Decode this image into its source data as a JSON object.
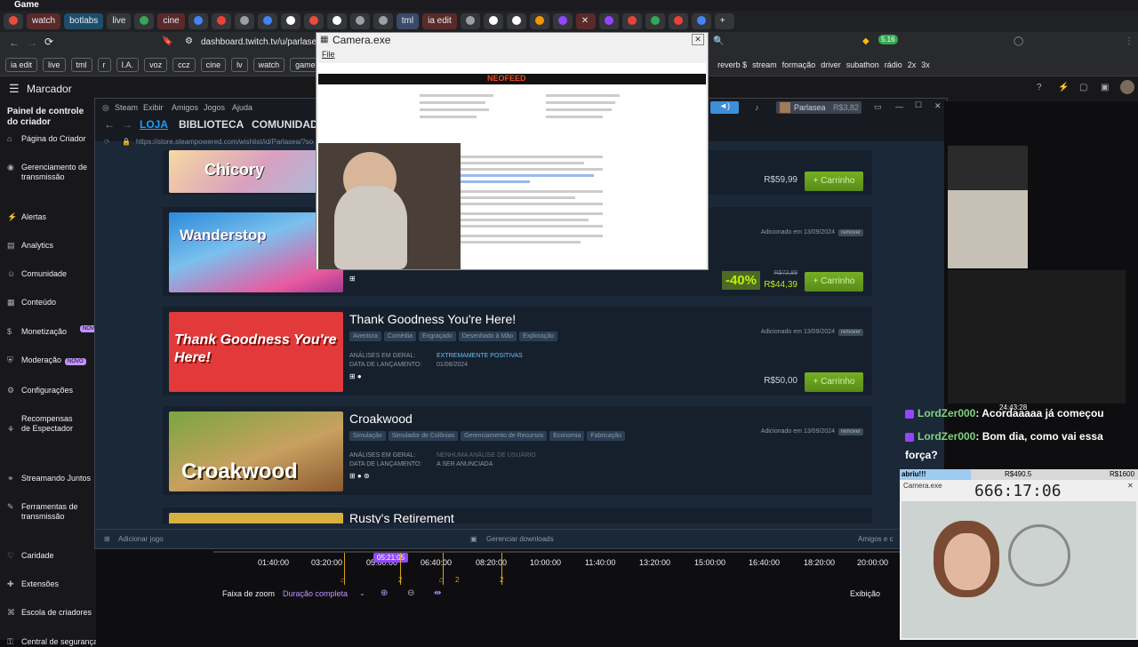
{
  "window_title": "Game",
  "tabs": [
    "watch",
    "botlabs",
    "live",
    "cine",
    "tml",
    "ia edit"
  ],
  "address_bar": {
    "url": "dashboard.twitch.tv/u/parlasea"
  },
  "bookmarks_left": [
    "ia edit",
    "live",
    "tml",
    "r",
    "I.A.",
    "voz",
    "ccz",
    "cine",
    "lv",
    "watch",
    "games"
  ],
  "bookmarks_right": [
    "reverb $",
    "stream",
    "formação",
    "driver",
    "subathon",
    "rádio",
    "2x",
    "3x"
  ],
  "twitch": {
    "title": "Marcador",
    "panel_title": "Painel de controle do criador",
    "sidebar": [
      {
        "label": "Página do Criador",
        "icon": "home-icon"
      },
      {
        "label": "Gerenciamento de transmissão",
        "icon": "broadcast-icon"
      },
      {
        "label": "Alertas",
        "icon": "bolt-icon"
      },
      {
        "label": "Analytics",
        "icon": "chart-icon"
      },
      {
        "label": "Comunidade",
        "icon": "community-icon"
      },
      {
        "label": "Conteúdo",
        "icon": "content-icon"
      },
      {
        "label": "Monetização",
        "icon": "money-icon"
      },
      {
        "label": "Moderação",
        "icon": "shield-icon",
        "badge": "NOVO"
      },
      {
        "label": "Configurações",
        "icon": "gear-icon"
      },
      {
        "label": "Recompensas de Espectador",
        "icon": "gift-icon",
        "badge": "NOVO"
      },
      {
        "label": "Streamando Juntos",
        "icon": "people-icon"
      },
      {
        "label": "Ferramentas de transmissão",
        "icon": "tools-icon"
      },
      {
        "label": "Caridade",
        "icon": "heart-icon"
      },
      {
        "label": "Extensões",
        "icon": "puzzle-icon"
      },
      {
        "label": "Escola de criadores",
        "icon": "school-icon"
      },
      {
        "label": "Central de segurança",
        "icon": "lock-icon"
      }
    ]
  },
  "steam": {
    "menu": [
      "Steam",
      "Exibir",
      "Amigos",
      "Jogos",
      "Ajuda"
    ],
    "nav": [
      "LOJA",
      "BIBLIOTECA",
      "COMUNIDADE"
    ],
    "url": "https://store.steampowered.com/wishlist/id/Parlasea/?sort",
    "user": "Parlasea",
    "balance": "R$3,82",
    "footer_left": "Adicionar jogo",
    "footer_center": "Gerenciar downloads",
    "footer_right": "Amigos e c",
    "games": [
      {
        "title": "Chicory",
        "price": "R$59,99",
        "cart": "+ Carrinho"
      },
      {
        "title": "Wanderstop",
        "discount": "-40%",
        "old_price": "R$72,99",
        "price": "R$44,39",
        "cart": "+ Carrinho",
        "added": "Adicionado em 13/09/2024",
        "remove": "remover"
      },
      {
        "title": "Thank Goodness You're Here!",
        "tags": [
          "Aventura",
          "Comédia",
          "Engraçado",
          "Desenhado à Mão",
          "Exploração"
        ],
        "reviews_label": "ANÁLISES EM GERAL:",
        "reviews": "EXTREMAMENTE POSITIVAS",
        "release_label": "DATA DE LANÇAMENTO:",
        "release": "01/08/2024",
        "added": "Adicionado em 13/09/2024",
        "remove": "remover",
        "price": "R$50,00",
        "cart": "+ Carrinho"
      },
      {
        "title": "Croakwood",
        "tags": [
          "Simulação",
          "Simulador de Colônias",
          "Gerenciamento de Recursos",
          "Economia",
          "Fabricação"
        ],
        "reviews_label": "ANÁLISES EM GERAL:",
        "reviews": "NENHUMA ANÁLISE DE USUÁRIO",
        "release_label": "DATA DE LANÇAMENTO:",
        "release": "A SER ANUNCIADA",
        "added": "Adicionado em 13/09/2024",
        "remove": "remover"
      },
      {
        "title": "Rusty's Retirement"
      }
    ]
  },
  "camera": {
    "title": "Camera.exe",
    "menu": "File",
    "site": "NEOFEED"
  },
  "timeline": {
    "ticks": [
      "01:40:00",
      "03:20:00",
      "05:00:00",
      "06:40:00",
      "08:20:00",
      "10:00:00",
      "11:40:00",
      "13:20:00",
      "15:00:00",
      "16:40:00",
      "18:20:00",
      "20:00:00"
    ],
    "cursor": "05:21:05",
    "zoom_label": "Faixa de zoom",
    "zoom_value": "Duração completa",
    "exhibit": "Exibição",
    "marker_count": "2"
  },
  "chat": [
    {
      "user": "LordZer000",
      "text": ": Acordaaaaa já começou"
    },
    {
      "user": "LordZer000",
      "text": ": Bom dia, como vai essa"
    },
    {
      "user": "",
      "text": "força?"
    }
  ],
  "right_overlay": {
    "label": "abriu!!!",
    "value1": "R$490.5",
    "value2": "R$1600",
    "timer": "666:17:06",
    "cam_title": "Camera.exe",
    "clock": "24:43:28"
  },
  "colors": {
    "steam_bg": "#1b2838",
    "twitch_purple": "#9147ff",
    "cart_green": "#5c7e10",
    "chat_name": "#7fd27f",
    "review_blue": "#66c0f4",
    "discount_green": "#4c6b22"
  }
}
